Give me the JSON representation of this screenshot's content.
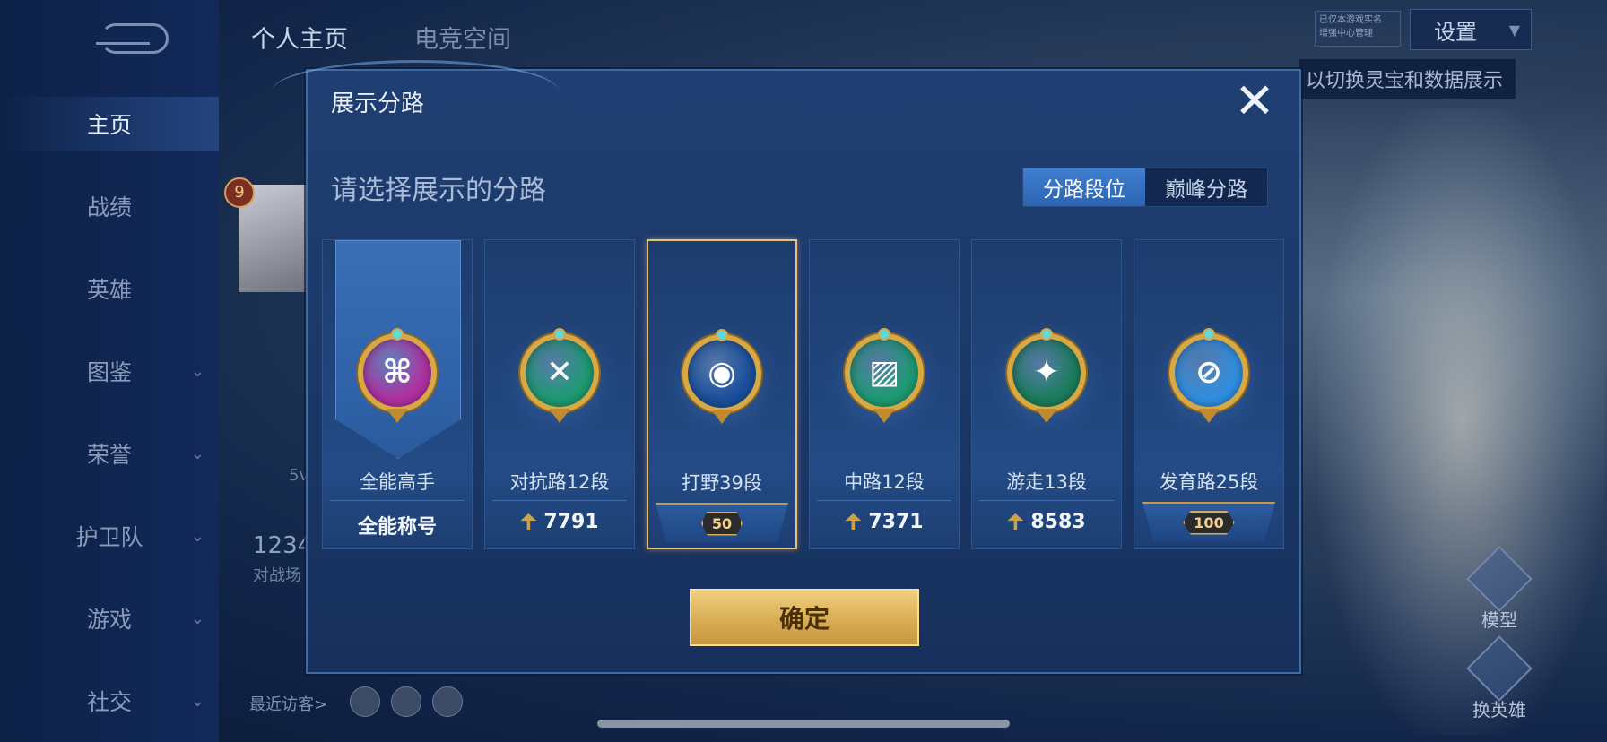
{
  "nav": {
    "items": [
      {
        "label": "主页",
        "active": true,
        "chevron": false
      },
      {
        "label": "战绩",
        "active": false,
        "chevron": false
      },
      {
        "label": "英雄",
        "active": false,
        "chevron": false
      },
      {
        "label": "图鉴",
        "active": false,
        "chevron": true
      },
      {
        "label": "荣誉",
        "active": false,
        "chevron": true
      },
      {
        "label": "护卫队",
        "active": false,
        "chevron": true
      },
      {
        "label": "游戏",
        "active": false,
        "chevron": true
      },
      {
        "label": "社交",
        "active": false,
        "chevron": true
      }
    ]
  },
  "top_tabs": [
    "个人主页",
    "电竞空间"
  ],
  "settings_label": "设置",
  "notice_text": [
    "已仅本游戏实名",
    "增强中心管理"
  ],
  "bg_tip": "以切换灵宝和数据展示",
  "background": {
    "level": "9",
    "number": "1234",
    "number_sub": "对战场",
    "tag_5v": "5v",
    "visitors_label": "最近访客>",
    "right_icons": [
      "模型",
      "换英雄"
    ]
  },
  "dialog": {
    "title": "展示分路",
    "subtitle": "请选择展示的分路",
    "toggle": [
      {
        "label": "分路段位",
        "active": true
      },
      {
        "label": "巅峰分路",
        "active": false
      }
    ],
    "cards": [
      {
        "label": "全能高手",
        "value": "全能称号",
        "value_type": "text",
        "emblem_color": "#b0309f",
        "icon": "allround-emblem-icon",
        "selected": false
      },
      {
        "label": "对抗路12段",
        "value": "7791",
        "value_type": "points",
        "emblem_color": "#1e9a72",
        "icon": "clash-lane-emblem-icon",
        "selected": false
      },
      {
        "label": "打野39段",
        "value": "50",
        "value_type": "star_badge",
        "emblem_color": "#1a4f9c",
        "icon": "jungle-emblem-icon",
        "selected": true
      },
      {
        "label": "中路12段",
        "value": "7371",
        "value_type": "points",
        "emblem_color": "#1e9a72",
        "icon": "mid-lane-emblem-icon",
        "selected": false
      },
      {
        "label": "游走13段",
        "value": "8583",
        "value_type": "points",
        "emblem_color": "#1b7d5c",
        "icon": "roam-emblem-icon",
        "selected": false
      },
      {
        "label": "发育路25段",
        "value": "100",
        "value_type": "star_badge",
        "emblem_color": "#2f8fe0",
        "icon": "farm-lane-emblem-icon",
        "selected": false
      }
    ],
    "confirm_label": "确定"
  }
}
